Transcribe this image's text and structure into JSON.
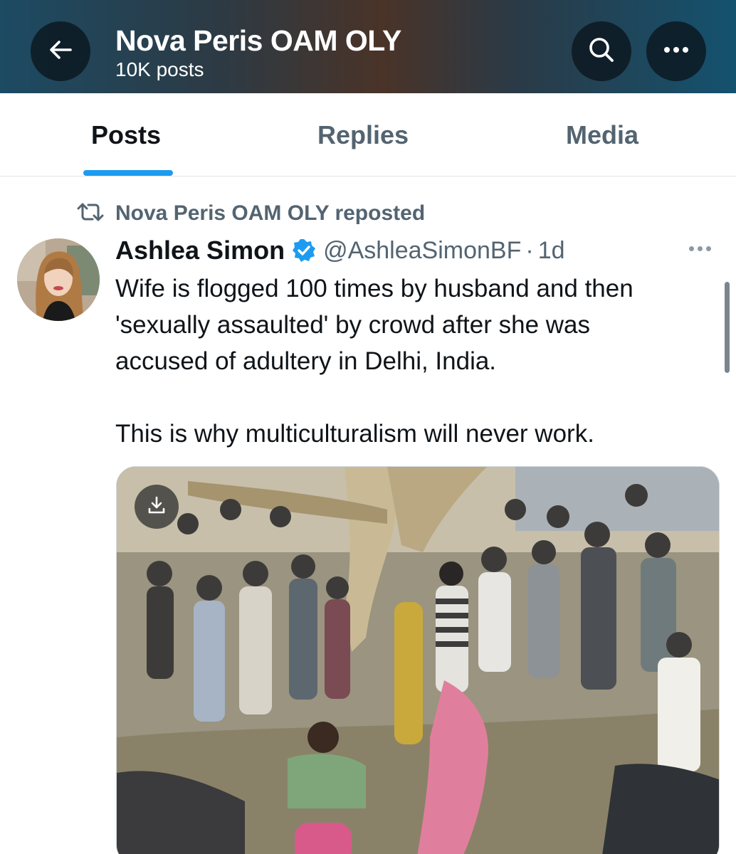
{
  "header": {
    "title": "Nova Peris OAM OLY",
    "subtitle": "10K posts",
    "back_icon": "arrow-left-icon",
    "search_icon": "search-icon",
    "more_icon": "more-horizontal-icon"
  },
  "tabs": [
    {
      "label": "Posts",
      "active": true
    },
    {
      "label": "Replies",
      "active": false
    },
    {
      "label": "Media",
      "active": false
    }
  ],
  "accent_color": "#1d9bf0",
  "repost": {
    "icon": "repost-icon",
    "text": "Nova Peris OAM OLY reposted"
  },
  "tweet": {
    "author_name": "Ashlea Simon",
    "verified": true,
    "handle": "@AshleaSimonBF",
    "separator": "·",
    "time": "1d",
    "text_lines": [
      "Wife is flogged 100 times by husband and then",
      "'sexually assaulted' by crowd after she was",
      "accused of adultery in Delhi, India.",
      "This is why multiculturalism will never work."
    ],
    "media_icon": "download-icon"
  }
}
